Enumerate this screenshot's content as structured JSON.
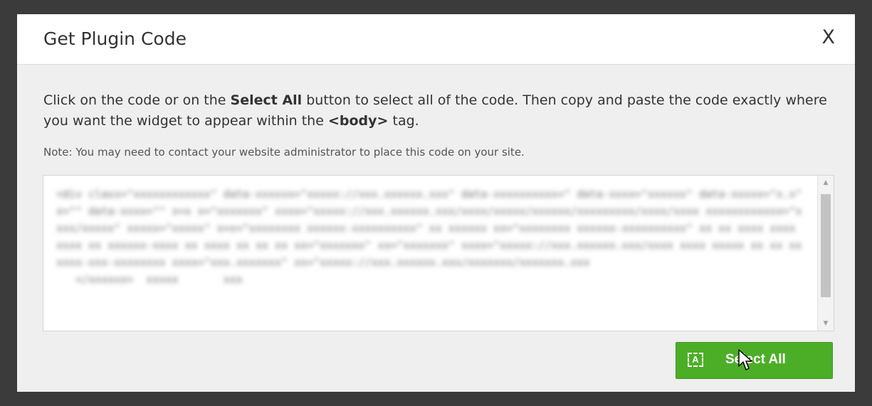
{
  "dialog": {
    "title": "Get Plugin Code",
    "close_label": "X",
    "instructions": {
      "part1": "Click on the code or on the ",
      "select_all_bold": "Select All",
      "part2": " button to select all of the code. Then copy and paste the code exactly where you want the widget to appear within the ",
      "body_tag_bold": "<body>",
      "part3": " tag."
    },
    "note": "Note: You may need to contact your website administrator to place this code on your site.",
    "select_all_button": {
      "label": "Select All",
      "icon_glyph": "A",
      "icon": "select-all-icon"
    }
  },
  "colors": {
    "button_green": "#4cae27",
    "backdrop": "#3b3b3b",
    "modal_body": "#efefef"
  }
}
